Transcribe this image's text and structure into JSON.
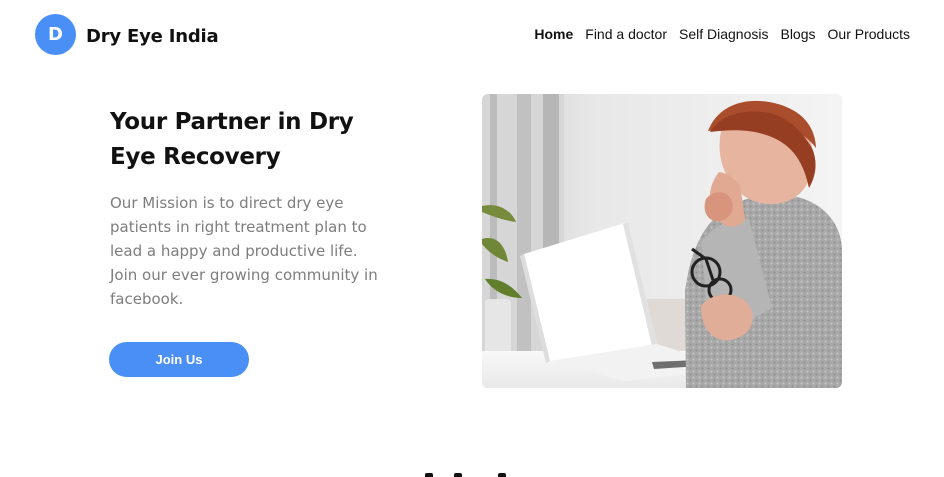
{
  "header": {
    "logo_letter": "D",
    "brand_name": "Dry Eye India",
    "nav": [
      {
        "label": "Home",
        "active": true
      },
      {
        "label": "Find a doctor",
        "active": false
      },
      {
        "label": "Self Diagnosis",
        "active": false
      },
      {
        "label": "Blogs",
        "active": false
      },
      {
        "label": "Our Products",
        "active": false
      }
    ]
  },
  "hero": {
    "title": "Your Partner in Dry Eye Recovery",
    "description": "Our Mission is to direct dry eye patients in right treatment plan to lead a happy and productive life. Join our ever growing community in facebook.",
    "button_label": "Join Us",
    "image_icon": "woman-with-laptop-illustration"
  },
  "colors": {
    "accent": "#4a8ff6",
    "heading": "#111111",
    "body_text": "#7d7d7d",
    "background": "#ffffff"
  }
}
